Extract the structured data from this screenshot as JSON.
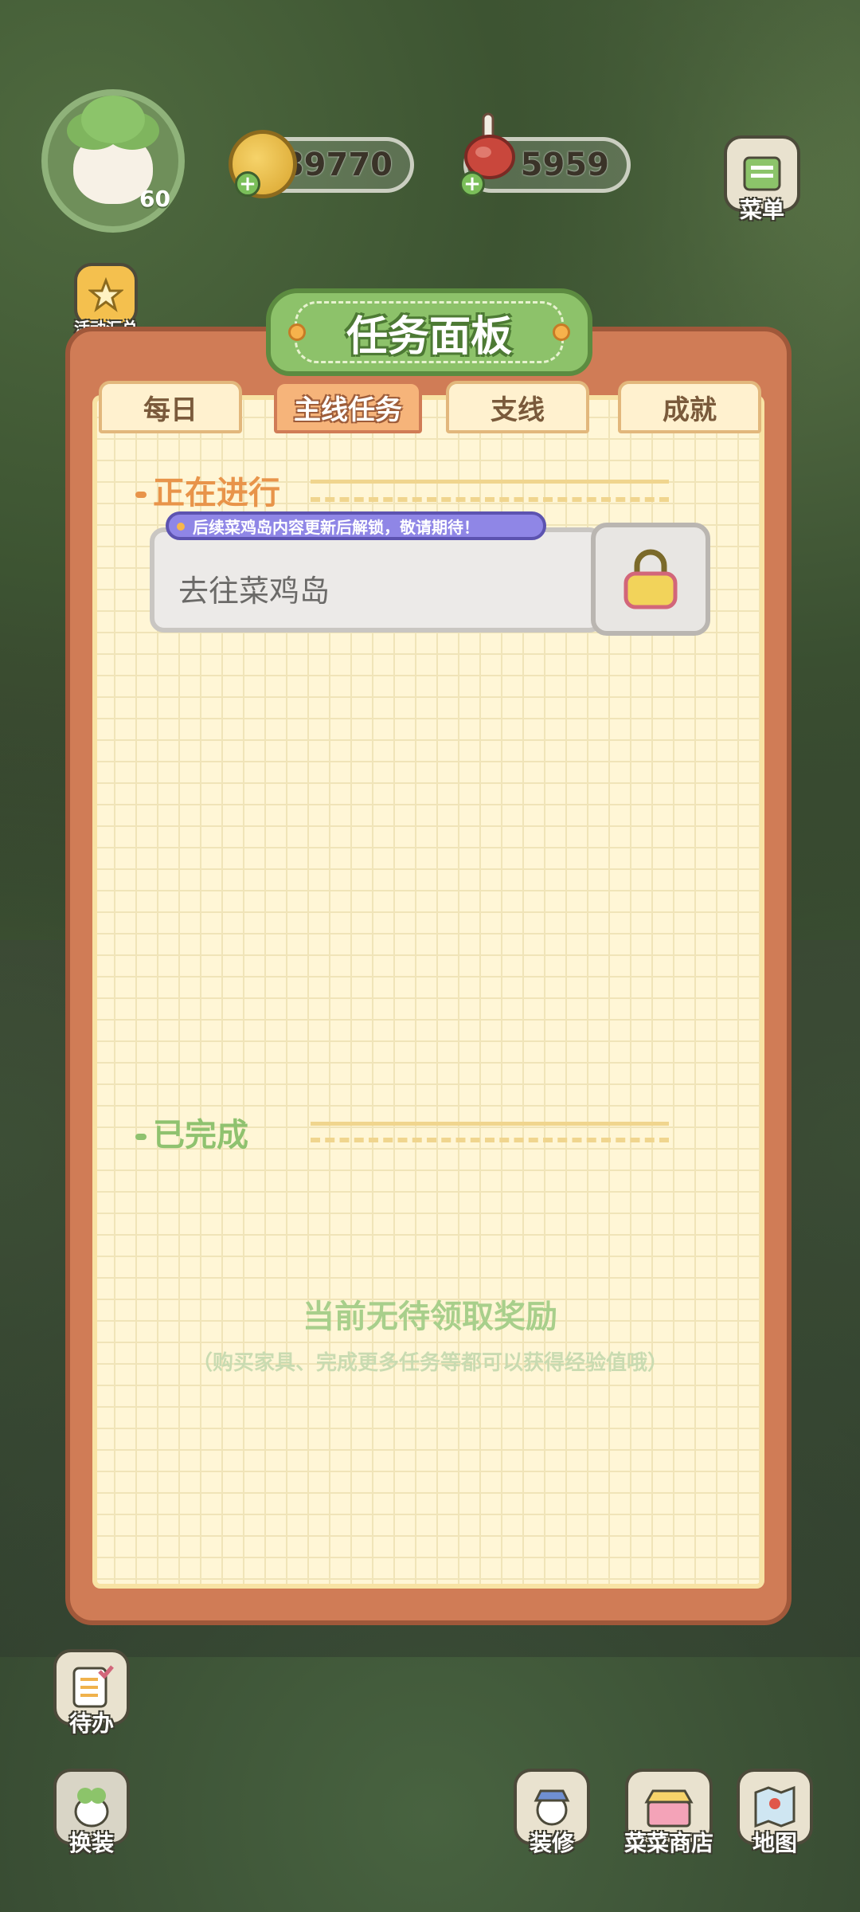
{
  "hud": {
    "level": "60",
    "coins": "89770",
    "meat": "5959",
    "menu_label": "菜单",
    "events_label": "活动汇总"
  },
  "panel": {
    "title": "任务面板",
    "tabs": [
      {
        "label": "每日",
        "active": false
      },
      {
        "label": "主线任务",
        "active": true
      },
      {
        "label": "支线",
        "active": false
      },
      {
        "label": "成就",
        "active": false
      }
    ],
    "in_progress_heading": "正在进行",
    "notice": "后续菜鸡岛内容更新后解锁，敬请期待！",
    "task_name": "去往菜鸡岛",
    "completed_heading": "已完成",
    "empty_title": "当前无待领取奖励",
    "empty_subtitle": "（购买家具、完成更多任务等都可以获得经验值哦）"
  },
  "bottom": {
    "todo_label": "待办",
    "dressup_label": "换装",
    "decorate_label": "装修",
    "shop_label": "菜菜商店",
    "map_label": "地图"
  },
  "colors": {
    "panel_frame": "#d07c56",
    "paper": "#fff6d6",
    "title_green": "#8dc26a",
    "in_progress_orange": "#e8944a",
    "completed_green": "#8fc26f",
    "notice_purple": "#8f86e6"
  }
}
